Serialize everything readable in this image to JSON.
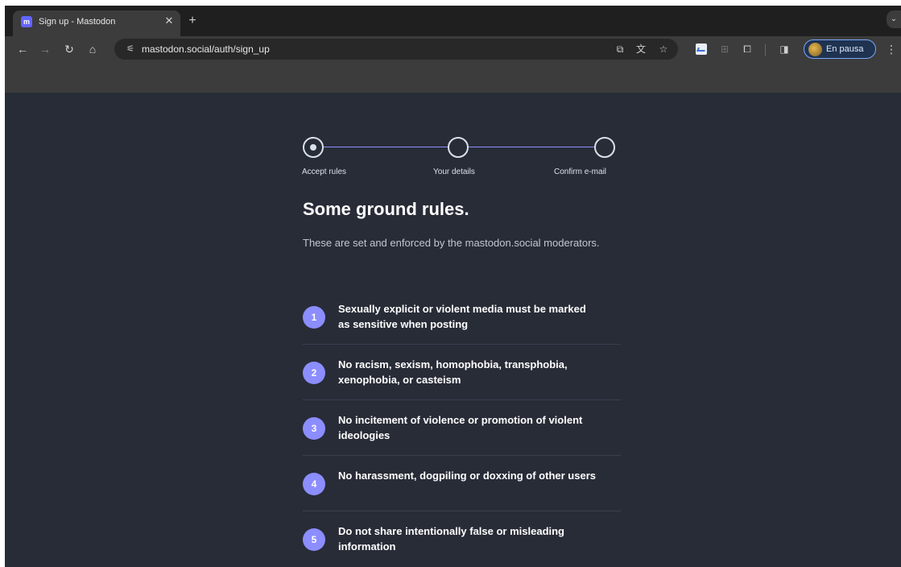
{
  "browser": {
    "tab": {
      "title": "Sign up - Mastodon",
      "favicon": "mastodon-logo"
    },
    "url": "mastodon.social/auth/sign_up",
    "profile_label": "En pausa"
  },
  "stepper": {
    "steps": [
      {
        "label": "Accept rules",
        "state": "active"
      },
      {
        "label": "Your details",
        "state": "pending"
      },
      {
        "label": "Confirm e-mail",
        "state": "pending"
      }
    ]
  },
  "page": {
    "title": "Some ground rules.",
    "lead": "These are set and enforced by the mastodon.social moderators."
  },
  "rules": [
    {
      "number": "1",
      "text": "Sexually explicit or violent media must be marked as sensitive when posting"
    },
    {
      "number": "2",
      "text": "No racism, sexism, homophobia, transphobia, xenophobia, or casteism"
    },
    {
      "number": "3",
      "text": "No incitement of violence or promotion of violent ideologies"
    },
    {
      "number": "4",
      "text": "No harassment, dogpiling or doxxing of other users"
    },
    {
      "number": "5",
      "text": "Do not share intentionally false or misleading information"
    }
  ],
  "colors": {
    "page_background": "#282c37",
    "accent": "#8c8dff",
    "text_primary": "#ffffff",
    "text_secondary": "#c0c7d1"
  }
}
